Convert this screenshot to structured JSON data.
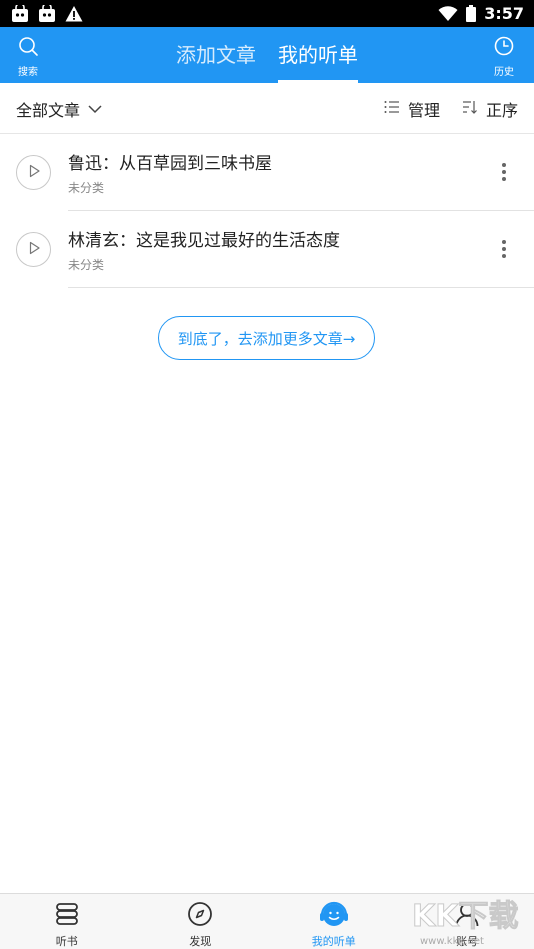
{
  "status_bar": {
    "time": "3:57"
  },
  "header": {
    "search_label": "搜索",
    "history_label": "历史",
    "tabs": [
      {
        "label": "添加文章",
        "active": false
      },
      {
        "label": "我的听单",
        "active": true
      }
    ]
  },
  "filter_bar": {
    "all_label": "全部文章",
    "manage_label": "管理",
    "order_label": "正序"
  },
  "articles": [
    {
      "title": "鲁迅：从百草园到三味书屋",
      "category": "未分类"
    },
    {
      "title": "林清玄：这是我见过最好的生活态度",
      "category": "未分类"
    }
  ],
  "end_button": "到底了，去添加更多文章→",
  "bottom_nav": [
    {
      "label": "听书",
      "icon": "book-stack-icon"
    },
    {
      "label": "发现",
      "icon": "compass-icon"
    },
    {
      "label": "我的听单",
      "icon": "headphone-smile-icon",
      "active": true
    },
    {
      "label": "账号",
      "icon": "user-icon"
    }
  ],
  "watermark": {
    "text": "KK下载",
    "url_text": "www.kkx.net"
  },
  "colors": {
    "accent": "#2196f3",
    "statusbar": "#000000"
  }
}
